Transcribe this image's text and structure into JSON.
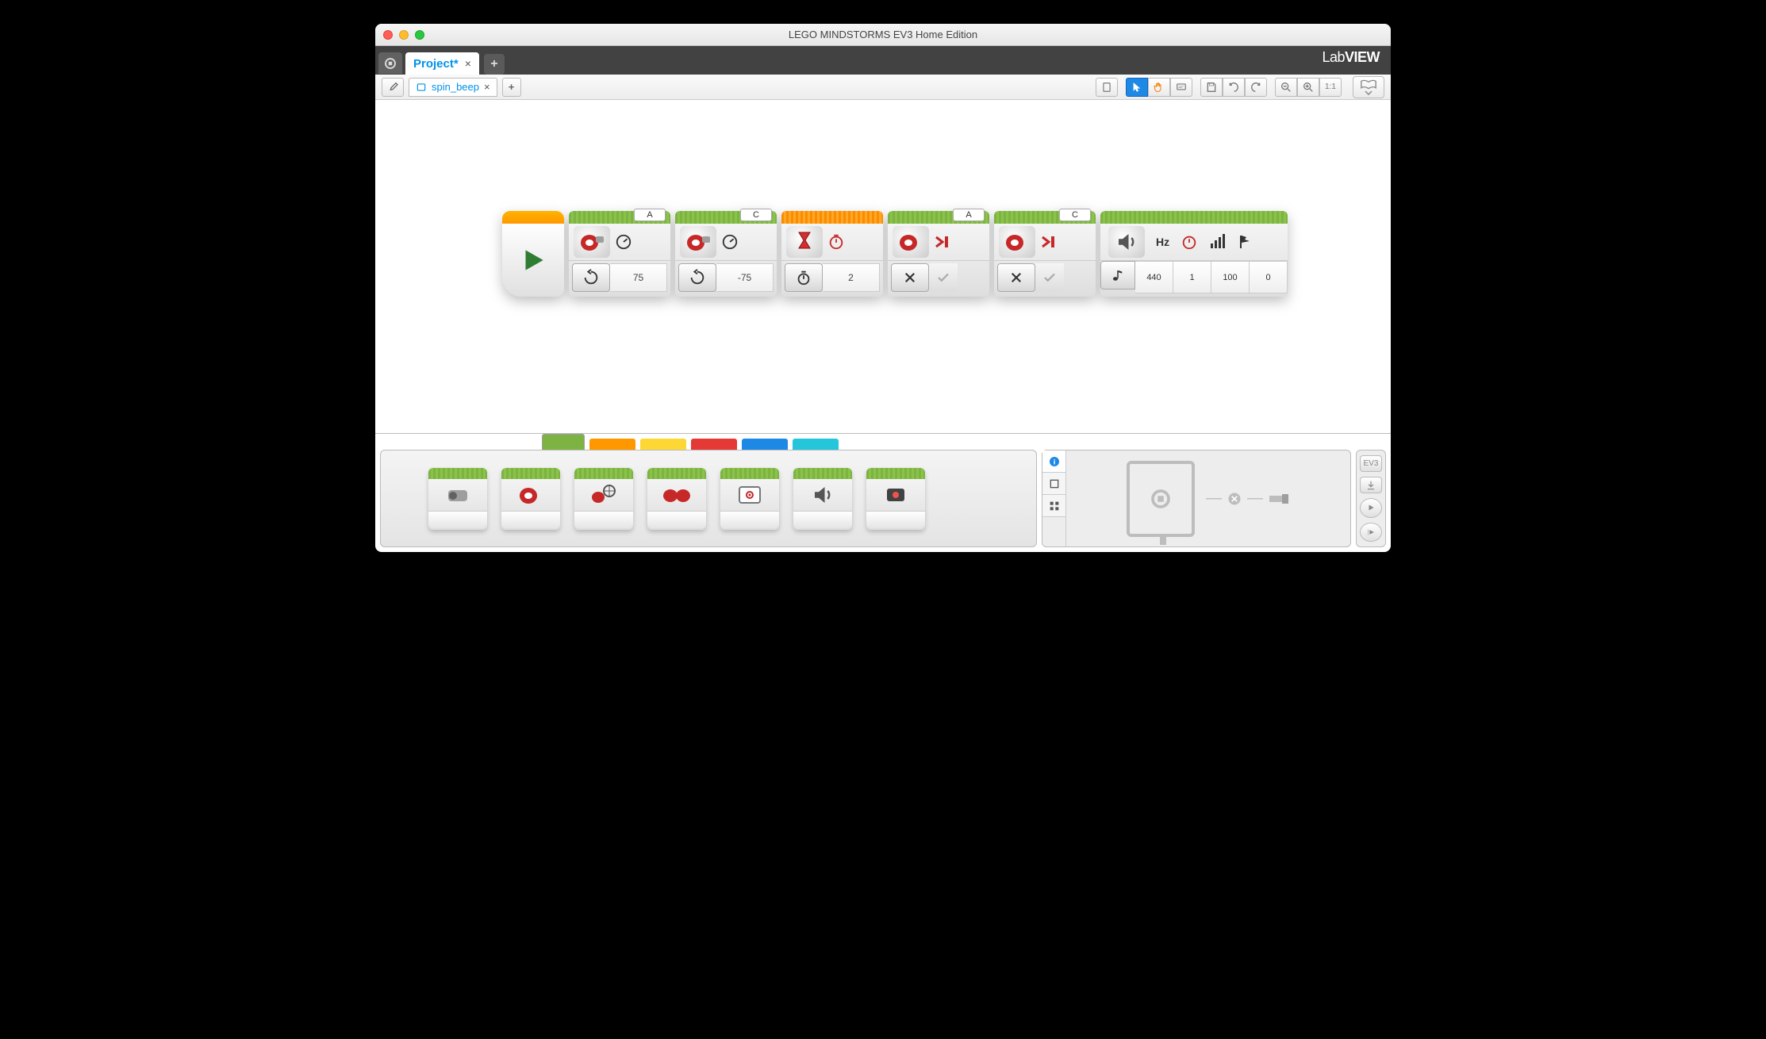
{
  "window": {
    "title": "LEGO MINDSTORMS EV3 Home Edition"
  },
  "brand": {
    "prefix": "Lab",
    "suffix": "VIEW"
  },
  "project_tab": {
    "label": "Project*"
  },
  "file_tab": {
    "label": "spin_beep"
  },
  "blocks": {
    "motor_a_on": {
      "port": "A",
      "power": "75"
    },
    "motor_c_on": {
      "port": "C",
      "power": "-75"
    },
    "wait": {
      "seconds": "2"
    },
    "motor_a_off": {
      "port": "A"
    },
    "motor_c_off": {
      "port": "C"
    },
    "sound": {
      "hz": "Hz",
      "freq": "440",
      "dur": "1",
      "vol": "100",
      "play": "0"
    }
  },
  "hw": {
    "label": "EV3"
  }
}
